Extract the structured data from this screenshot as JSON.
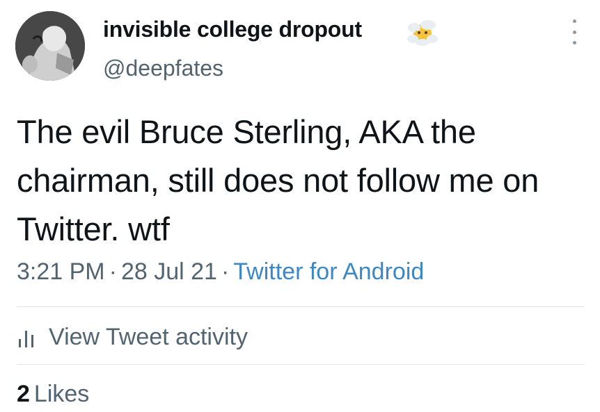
{
  "author": {
    "display_name": "invisible college dropout",
    "handle": "@deepfates",
    "emoji_icon": "face-in-clouds-icon",
    "avatar_icon": "avatar"
  },
  "tweet": {
    "text": "The evil Bruce Sterling, AKA the chairman, still does not follow me on Twitter. wtf",
    "time": "3:21 PM",
    "date": "28 Jul 21",
    "separator": "·",
    "source": "Twitter for Android"
  },
  "activity": {
    "label": "View Tweet activity",
    "icon": "bar-chart-icon"
  },
  "likes": {
    "count": "2",
    "label": "Likes"
  },
  "colors": {
    "text_primary": "#0f1419",
    "text_secondary": "#536471",
    "link": "#3c88c7",
    "divider": "#dfe3e6"
  },
  "menu_icon": "more-vertical-icon"
}
